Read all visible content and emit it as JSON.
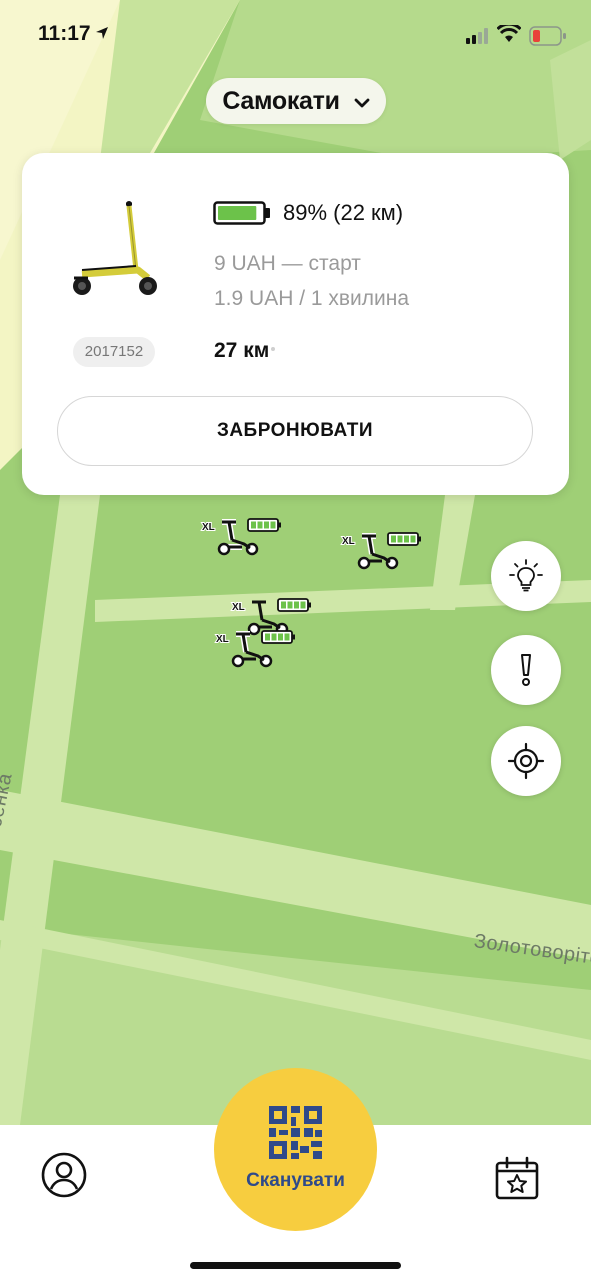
{
  "status_bar": {
    "time": "11:17"
  },
  "header": {
    "vehicle_type": "Самокати"
  },
  "card": {
    "scooter_id": "2017152",
    "battery_text": "89% (22 км)",
    "battery_level": 0.89,
    "price_start": "9 UAH — старт",
    "price_per_minute": "1.9 UAH / 1 хвилина",
    "distance": "27 км",
    "reserve_label": "ЗАБРОНЮВАТИ"
  },
  "map": {
    "streets": [
      "Миколи Лисенка",
      "Золотоворіто"
    ],
    "markers": [
      {
        "badge": "XL",
        "battery_level": 1.0
      },
      {
        "badge": "XL",
        "battery_level": 1.0
      },
      {
        "badge": "XL",
        "battery_level": 1.0
      },
      {
        "badge": "XL",
        "battery_level": 1.0
      }
    ]
  },
  "controls": [
    "lightbulb-icon",
    "alert-icon",
    "locate-icon"
  ],
  "bottom": {
    "scan_label": "Сканувати"
  },
  "colors": {
    "accent": "#f7cd3f",
    "map_green": "#9fcf76",
    "battery_green": "#6cc24a",
    "scan_text": "#2f4a8a"
  }
}
